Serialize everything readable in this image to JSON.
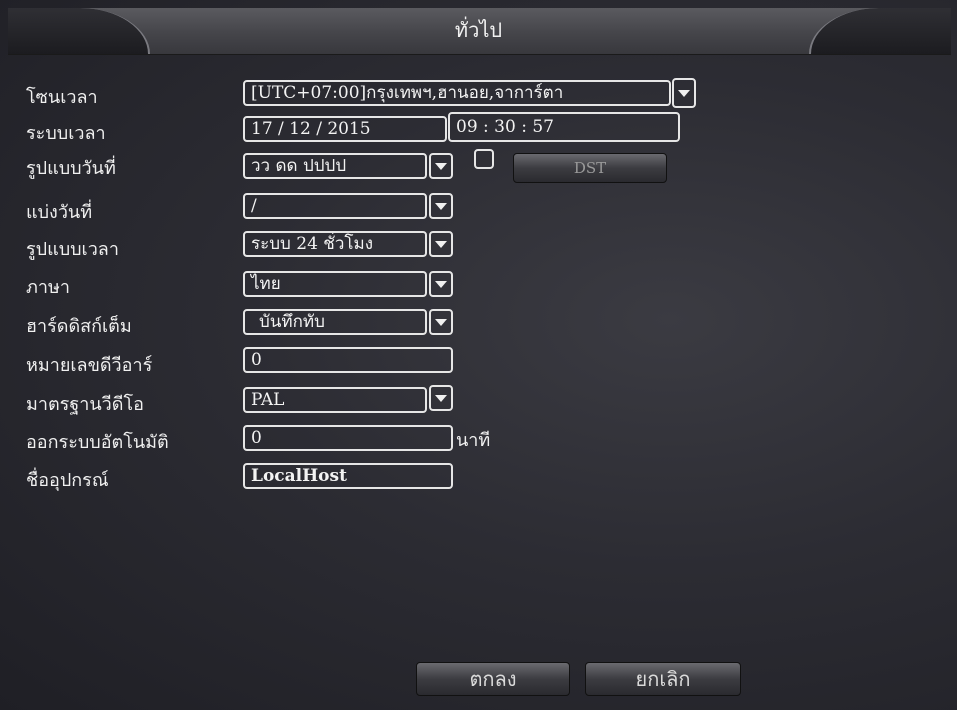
{
  "window": {
    "title": "ทั่วไป"
  },
  "labels": {
    "timezone": "โซนเวลา",
    "system_time": "ระบบเวลา",
    "date_format": "รูปแบบวันที่",
    "date_separator": "แบ่งวันที่",
    "time_format": "รูปแบบเวลา",
    "language": "ภาษา",
    "hdd_full": "ฮาร์ดดิสก์เต็ม",
    "dvr_number": "หมายเลขดีวีอาร์",
    "video_standard": "มาตรฐานวีดีโอ",
    "auto_logout": "ออกระบบอัตโนมัติ",
    "device_name": "ชื่ออุปกรณ์"
  },
  "values": {
    "timezone": "[UTC+07:00]กรุงเทพฯ,ฮานอย,จาการ์ตา",
    "date": "17  /  12  /  2015",
    "time": "09  :  30  :  57",
    "date_format": "วว ดด ปปปป",
    "date_separator": "/",
    "time_format": "ระบบ 24 ชั่วโมง",
    "language": "ไทย",
    "hdd_full": "บันทึกทับ",
    "dvr_number": "0",
    "video_standard": "PAL",
    "auto_logout": "0",
    "auto_logout_unit": "นาที",
    "device_name": "LocalHost",
    "dst_checked": false
  },
  "buttons": {
    "dst": "DST",
    "ok": "ตกลง",
    "cancel": "ยกเลิก"
  },
  "icons": {
    "dropdown": "chevron-down-icon"
  }
}
